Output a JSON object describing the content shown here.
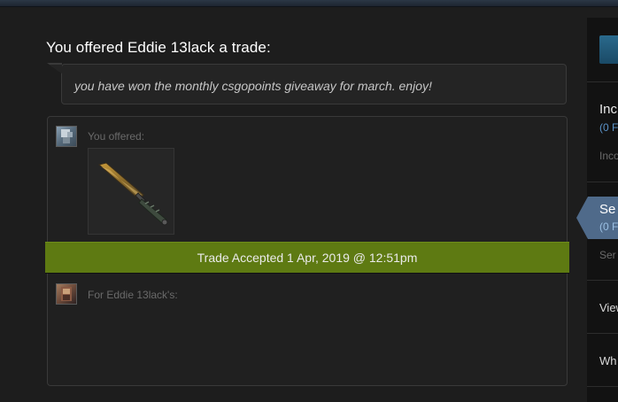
{
  "trade": {
    "title": "You offered Eddie 13lack a trade:",
    "message": "you have won the monthly csgopoints giveaway for march. enjoy!",
    "you_offered_label": "You offered:",
    "for_them_label": "For Eddie 13lack's:",
    "status_text": "Trade Accepted 1 Apr, 2019 @ 12:51pm",
    "offered_item_icon": "bayonet-knife-icon",
    "status_color": "#5e7a12"
  },
  "sidebar": {
    "incoming_title": "Inc",
    "incoming_count": "(0 F",
    "incoming_sub": "Inco",
    "sent_title": "Se",
    "sent_count": "(0 F",
    "sent_sub": "Ser",
    "view_label": "View",
    "what_label": "Wh",
    "accent_color": "#4f6a8a"
  }
}
